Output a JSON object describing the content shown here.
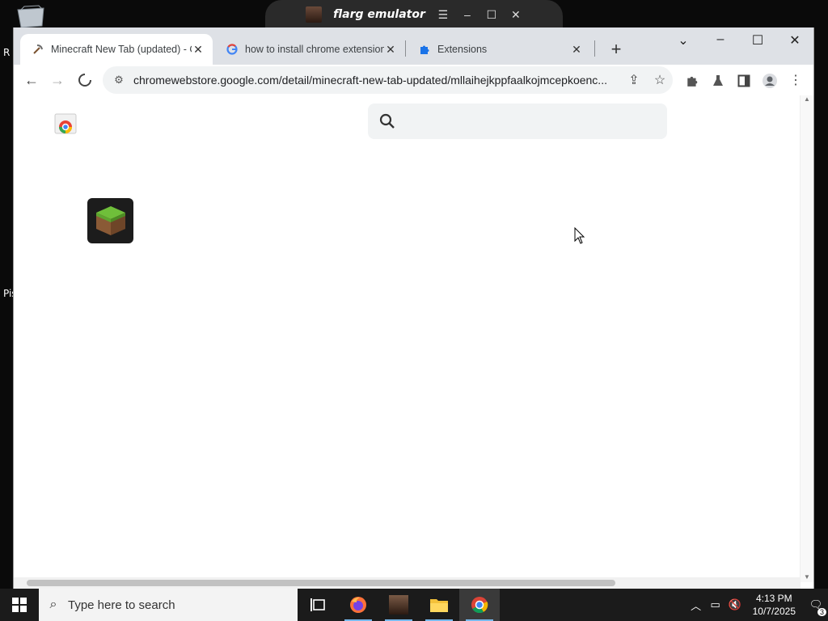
{
  "desktop": {
    "edge_letters": [
      "R",
      "Pis"
    ]
  },
  "emulator": {
    "title": "flarg emulator",
    "controls": [
      "☰",
      "–",
      "☐",
      "✕"
    ]
  },
  "browser": {
    "tabs": [
      {
        "label": "Minecraft New Tab (updated) - C",
        "active": true
      },
      {
        "label": "how to install chrome extension",
        "active": false
      },
      {
        "label": "Extensions",
        "active": false
      }
    ],
    "new_tab": "+",
    "window_controls": [
      "⌄",
      "–",
      "☐",
      "✕"
    ],
    "url": "chromewebstore.google.com/detail/minecraft-new-tab-updated/mllaihejkppfaalkojmcepkoenc..."
  },
  "page": {
    "search": {
      "placeholder": "",
      "value": ""
    }
  },
  "taskbar": {
    "search_placeholder": "Type here to search",
    "time": "4:13 PM",
    "date": "10/7/2025",
    "notification_count": "3"
  }
}
